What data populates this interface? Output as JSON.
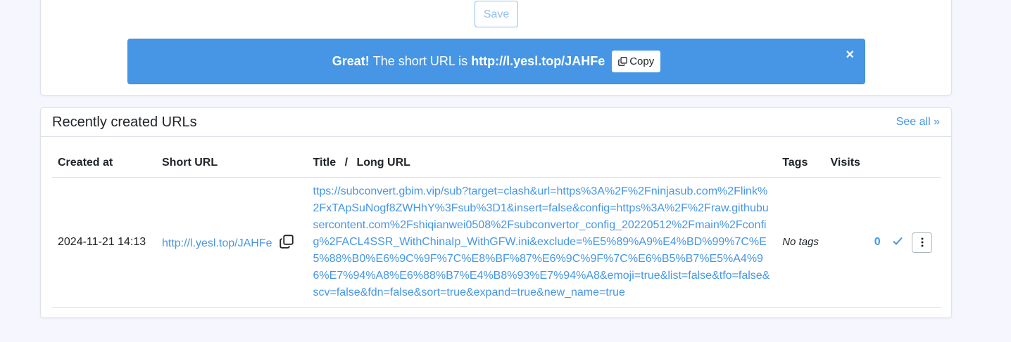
{
  "form": {
    "save_label": "Save"
  },
  "alert": {
    "strong": "Great!",
    "text": "The short URL is",
    "short_url": "http://l.yesl.top/JAHFe",
    "copy_label": "Copy",
    "close_symbol": "×",
    "bg_color": "#4696e5"
  },
  "recent": {
    "title": "Recently created URLs",
    "see_all": "See all »",
    "columns": {
      "created": "Created at",
      "short": "Short URL",
      "title_sep_a": "Title",
      "title_sep": "/",
      "title_sep_b": "Long URL",
      "tags": "Tags",
      "visits": "Visits"
    },
    "rows": [
      {
        "created": "2024-11-21 14:13",
        "short": "http://l.yesl.top/JAHFe",
        "long": "ttps://subconvert.gbim.vip/sub?target=clash&url=https%3A%2F%2Fninjasub.com%2Flink%2FxTApSuNogf8ZWHhY%3Fsub%3D1&insert=false&config=https%3A%2F%2Fraw.githubusercontent.com%2Fshiqianwei0508%2Fsubconvertor_config_20220512%2Fmain%2Fconfig%2FACL4SSR_WithChinaIp_WithGFW.ini&exclude=%E5%89%A9%E4%BD%99%7C%E5%88%B0%E6%9C%9F%7C%E8%BF%87%E6%9C%9F%7C%E6%B5%B7%E5%A4%96%E7%94%A8%E6%88%B7%E4%B8%93%E7%94%A8&emoji=true&list=false&tfo=false&scv=false&fdn=false&sort=true&expand=true&new_name=true",
        "tags": "No tags",
        "visits": "0"
      }
    ]
  },
  "icons": [
    "copy-icon",
    "close-icon",
    "check-icon",
    "kebab-menu-icon"
  ]
}
